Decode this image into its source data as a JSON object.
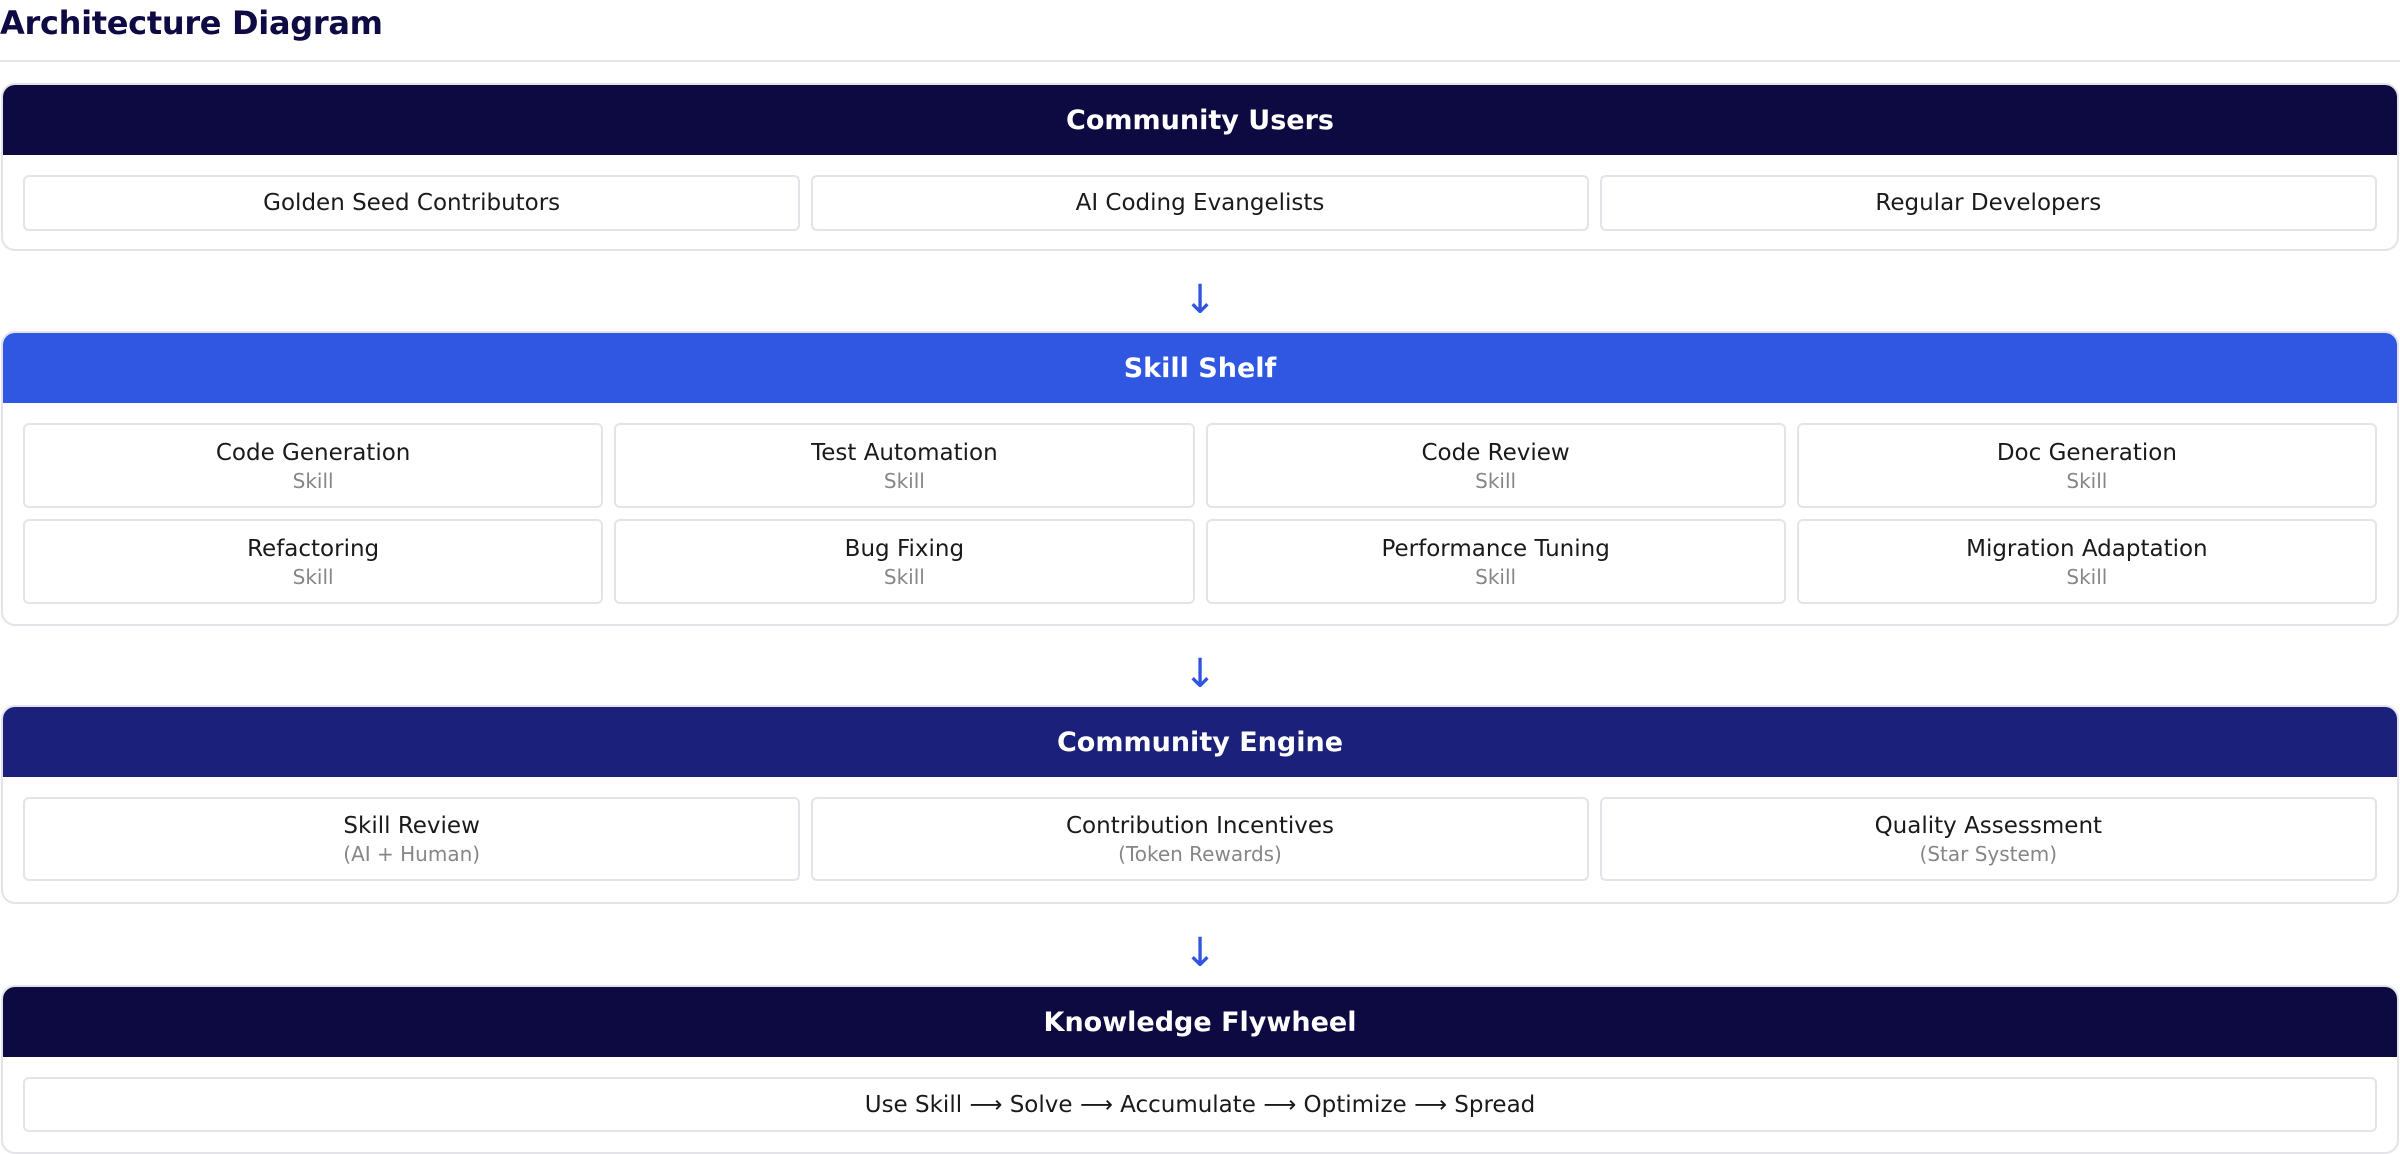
{
  "page_title": "Architecture Diagram",
  "colors": {
    "navy": "#0d0a42",
    "blue": "#2f57e2",
    "indigo": "#1b217a",
    "arrow": "#2f55e0"
  },
  "arrow_glyph": "↓",
  "layers": [
    {
      "title": "Community Users",
      "cards": [
        {
          "title": "Golden Seed Contributors"
        },
        {
          "title": "AI Coding Evangelists"
        },
        {
          "title": "Regular Developers"
        }
      ]
    },
    {
      "title": "Skill Shelf",
      "cards": [
        {
          "title": "Code Generation",
          "sub": "Skill"
        },
        {
          "title": "Test Automation",
          "sub": "Skill"
        },
        {
          "title": "Code Review",
          "sub": "Skill"
        },
        {
          "title": "Doc Generation",
          "sub": "Skill"
        },
        {
          "title": "Refactoring",
          "sub": "Skill"
        },
        {
          "title": "Bug Fixing",
          "sub": "Skill"
        },
        {
          "title": "Performance Tuning",
          "sub": "Skill"
        },
        {
          "title": "Migration Adaptation",
          "sub": "Skill"
        }
      ]
    },
    {
      "title": "Community Engine",
      "cards": [
        {
          "title": "Skill Review",
          "sub": "(AI + Human)"
        },
        {
          "title": "Contribution Incentives",
          "sub": "(Token Rewards)"
        },
        {
          "title": "Quality Assessment",
          "sub": "(Star System)"
        }
      ]
    },
    {
      "title": "Knowledge Flywheel",
      "cards": [
        {
          "title": "Use Skill ⟶ Solve ⟶ Accumulate ⟶ Optimize ⟶ Spread"
        }
      ]
    }
  ]
}
